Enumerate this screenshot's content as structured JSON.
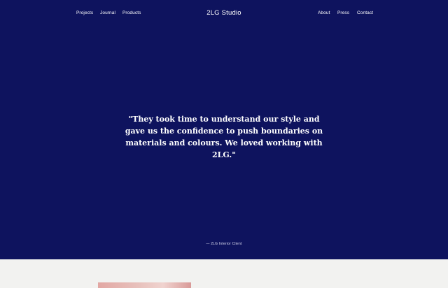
{
  "nav": {
    "left": [
      {
        "label": "Projects"
      },
      {
        "label": "Journal"
      },
      {
        "label": "Products"
      }
    ],
    "brand": "2LG Studio",
    "right": [
      {
        "label": "About"
      },
      {
        "label": "Press"
      },
      {
        "label": "Contact"
      }
    ]
  },
  "testimonial": {
    "quote": "\"They took time to understand our style and gave us the confidence to push boundaries on materials and colours. We loved working with 2LG.\"",
    "attribution": "— 2LG Interior Client"
  },
  "colors": {
    "hero_background": "#0e135e",
    "page_background": "#f2f2f0",
    "text": "#ffffff"
  }
}
